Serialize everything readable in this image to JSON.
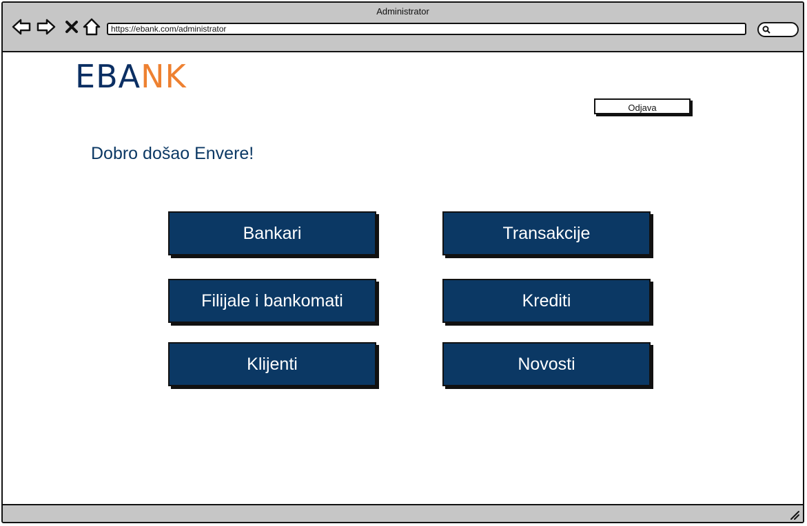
{
  "window": {
    "title": "Administrator"
  },
  "browser": {
    "url": "https://ebank.com/administrator"
  },
  "logo": {
    "part1": "EBA",
    "part2": "NK"
  },
  "header": {
    "logout_label": "Odjava"
  },
  "main": {
    "welcome": "Dobro došao Envere!",
    "tiles": [
      {
        "label": "Bankari"
      },
      {
        "label": "Transakcije"
      },
      {
        "label": "Filijale i bankomati"
      },
      {
        "label": "Krediti"
      },
      {
        "label": "Klijenti"
      },
      {
        "label": "Novosti"
      }
    ]
  },
  "colors": {
    "brand_dark": "#0b3864",
    "brand_orange": "#ee8131",
    "chrome": "#c6c6c6"
  }
}
